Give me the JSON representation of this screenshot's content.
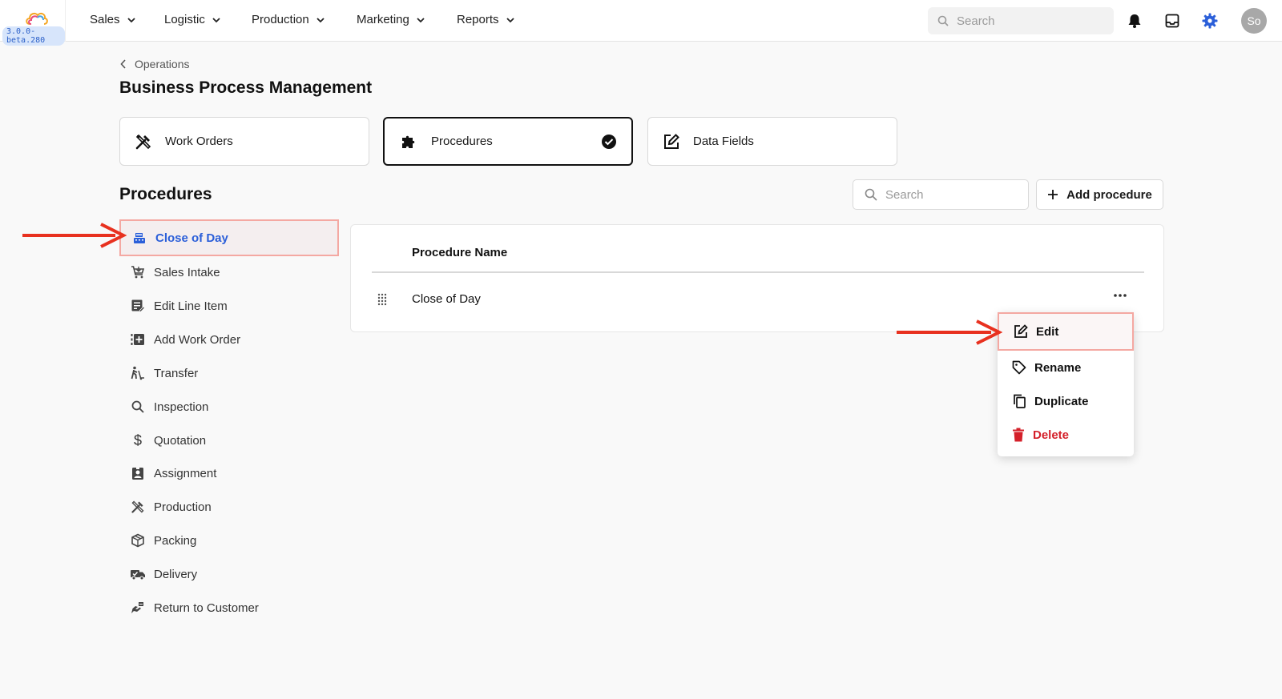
{
  "app": {
    "version": "3.0.0-beta.280"
  },
  "nav": {
    "items": [
      {
        "label": "Sales"
      },
      {
        "label": "Logistic"
      },
      {
        "label": "Production"
      },
      {
        "label": "Marketing"
      },
      {
        "label": "Reports"
      }
    ],
    "search_placeholder": "Search",
    "avatar_initials": "So"
  },
  "header": {
    "breadcrumb": "Operations",
    "title": "Business Process Management"
  },
  "categories": [
    {
      "label": "Work Orders",
      "icon": "tools-icon",
      "selected": false
    },
    {
      "label": "Procedures",
      "icon": "puzzle-icon",
      "selected": true
    },
    {
      "label": "Data Fields",
      "icon": "edit-box-icon",
      "selected": false
    }
  ],
  "procedures": {
    "title": "Procedures",
    "search_placeholder": "Search",
    "add_label": "Add procedure",
    "list": [
      {
        "label": "Close of Day",
        "icon": "register-icon",
        "active": true
      },
      {
        "label": "Sales Intake",
        "icon": "cart-icon"
      },
      {
        "label": "Edit Line Item",
        "icon": "edit-list-icon"
      },
      {
        "label": "Add Work Order",
        "icon": "add-box-icon"
      },
      {
        "label": "Transfer",
        "icon": "hand-truck-icon"
      },
      {
        "label": "Inspection",
        "icon": "magnifier-icon"
      },
      {
        "label": "Quotation",
        "icon": "dollar-icon"
      },
      {
        "label": "Assignment",
        "icon": "badge-icon"
      },
      {
        "label": "Production",
        "icon": "tools-icon"
      },
      {
        "label": "Packing",
        "icon": "box-icon"
      },
      {
        "label": "Delivery",
        "icon": "truck-icon"
      },
      {
        "label": "Return to Customer",
        "icon": "return-icon"
      }
    ]
  },
  "table": {
    "column_header": "Procedure Name",
    "rows": [
      {
        "name": "Close of Day"
      }
    ]
  },
  "context_menu": {
    "items": [
      {
        "label": "Edit",
        "icon": "edit-icon",
        "highlighted": true
      },
      {
        "label": "Rename",
        "icon": "tag-icon"
      },
      {
        "label": "Duplicate",
        "icon": "copy-icon"
      },
      {
        "label": "Delete",
        "icon": "trash-icon",
        "danger": true
      }
    ]
  },
  "colors": {
    "accent": "#2b5fd9",
    "danger": "#d4202a",
    "annotation_arrow": "#e8311f",
    "highlight_border": "#f4a8a2"
  }
}
